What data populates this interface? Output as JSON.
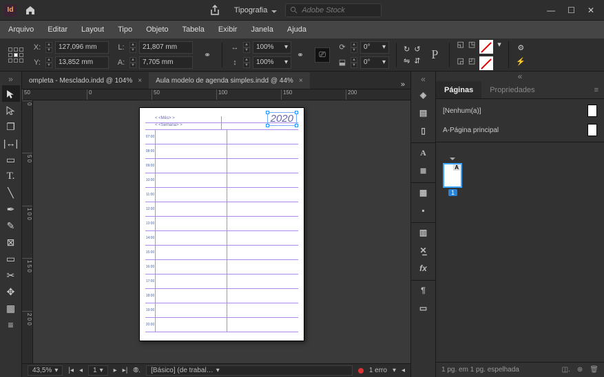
{
  "app": {
    "badge": "Id",
    "workspace": "Tipografia",
    "searchPlaceholder": "Adobe Stock"
  },
  "menu": [
    "Arquivo",
    "Editar",
    "Layout",
    "Tipo",
    "Objeto",
    "Tabela",
    "Exibir",
    "Janela",
    "Ajuda"
  ],
  "ctrl": {
    "x_label": "X:",
    "x": "127,096 mm",
    "y_label": "Y:",
    "y": "13,852 mm",
    "w_label": "L:",
    "w": "21,807 mm",
    "h_label": "A:",
    "h": "7,705 mm",
    "sx": "100%",
    "sy": "100%",
    "rot": "0°",
    "shear": "0°"
  },
  "tabs": [
    {
      "label": "ompleta - Mesclado.indd @ 104%",
      "active": false
    },
    {
      "label": "Aula modelo de agenda simples.indd @ 44%",
      "active": true
    }
  ],
  "rulerH": [
    "50",
    "0",
    "50",
    "100",
    "150",
    "200"
  ],
  "rulerV": [
    "0",
    "5 0",
    "1 0 0",
    "1 5 0",
    "2 0 0"
  ],
  "page": {
    "year": "2020",
    "hdr1": "< <Mês> >",
    "hdr2": "< <Semana> >",
    "hours": [
      "07:00",
      "08:00",
      "09:00",
      "10:00",
      "11:00",
      "12:00",
      "13:00",
      "14:00",
      "15:00",
      "16:00",
      "17:00",
      "18:00",
      "19:00",
      "20:00"
    ]
  },
  "status": {
    "zoom": "43,5%",
    "page": "1",
    "style": "[Básico] (de trabal…",
    "errors": "1 erro",
    "errorColor": "#d33"
  },
  "rpanel": {
    "tab1": "Páginas",
    "tab2": "Propriedades",
    "master1": "[Nenhum(a)]",
    "master2": "A-Página principal",
    "pgLetter": "A",
    "pgNum": "1",
    "footer": "1 pg. em 1 pg. espelhada"
  }
}
